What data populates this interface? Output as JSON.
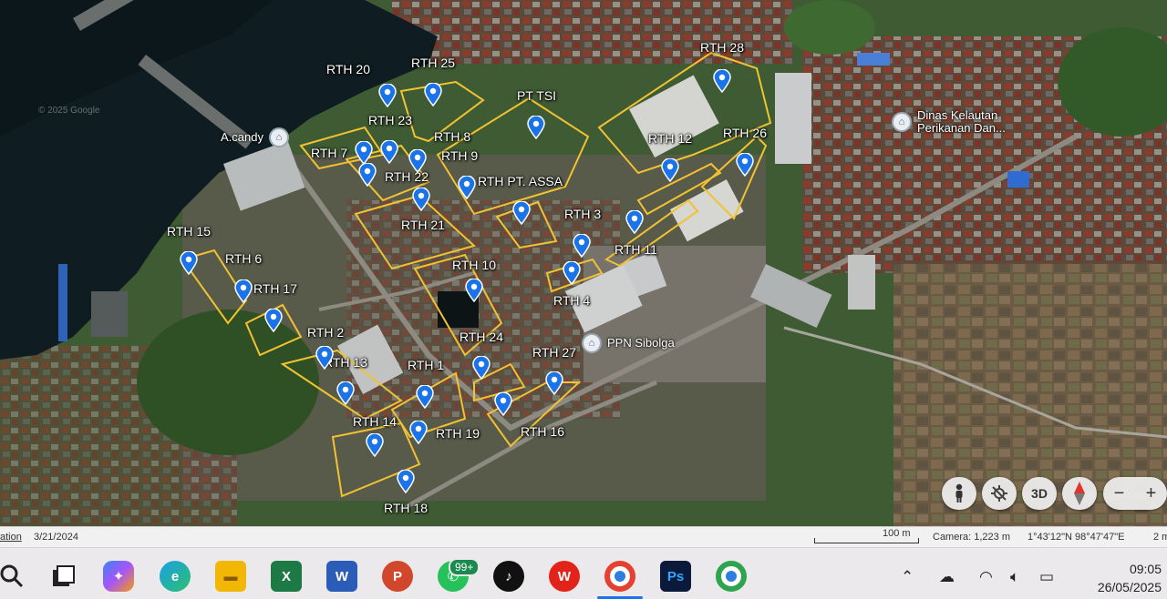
{
  "map": {
    "labels": {
      "rth20": "RTH 20",
      "rth25": "RTH 25",
      "rth28": "RTH 28",
      "pt_tsi": "PT TSI",
      "rth23": "RTH 23",
      "rth8": "RTH 8",
      "rth12": "RTH 12",
      "rth26": "RTH 26",
      "rth7": "RTH 7",
      "rth9": "RTH 9",
      "rth22": "RTH 22",
      "rth_pt_assa": "RTH PT. ASSA",
      "rth21": "RTH 21",
      "rth3": "RTH 3",
      "rth15": "RTH 15",
      "rth11": "RTH 11",
      "rth6": "RTH 6",
      "rth10": "RTH 10",
      "rth17": "RTH 17",
      "rth4": "RTH 4",
      "rth2": "RTH 2",
      "rth24": "RTH 24",
      "rth13": "RTH 13",
      "rth27": "RTH 27",
      "rth1": "RTH 1",
      "rth14": "RTH 14",
      "rth19": "RTH 19",
      "rth16": "RTH 16",
      "rth18": "RTH 18"
    },
    "pois": {
      "acandy": "A.candy",
      "dinas_line1": "Dinas Kelautan",
      "dinas_line2": "Perikanan Dan...",
      "ppn": "PPN Sibolga"
    },
    "watermark": "© 2025 Google",
    "controls": {
      "three_d": "3D",
      "zoom_out": "−",
      "zoom_in": "+"
    }
  },
  "status": {
    "attribution": "ation",
    "date": "3/21/2024",
    "scale": "100 m",
    "camera": "Camera: 1,223 m",
    "coords": "1°43'12\"N 98°47'47\"E",
    "trail": "2 m"
  },
  "taskbar": {
    "whatsapp_badge": "99+",
    "time": "09:05",
    "date": "26/05/2025"
  },
  "colors": {
    "boundary": "#f2c230",
    "pin": "#1a73e8",
    "water": "#0f1d22",
    "land": "#3c5a30"
  }
}
